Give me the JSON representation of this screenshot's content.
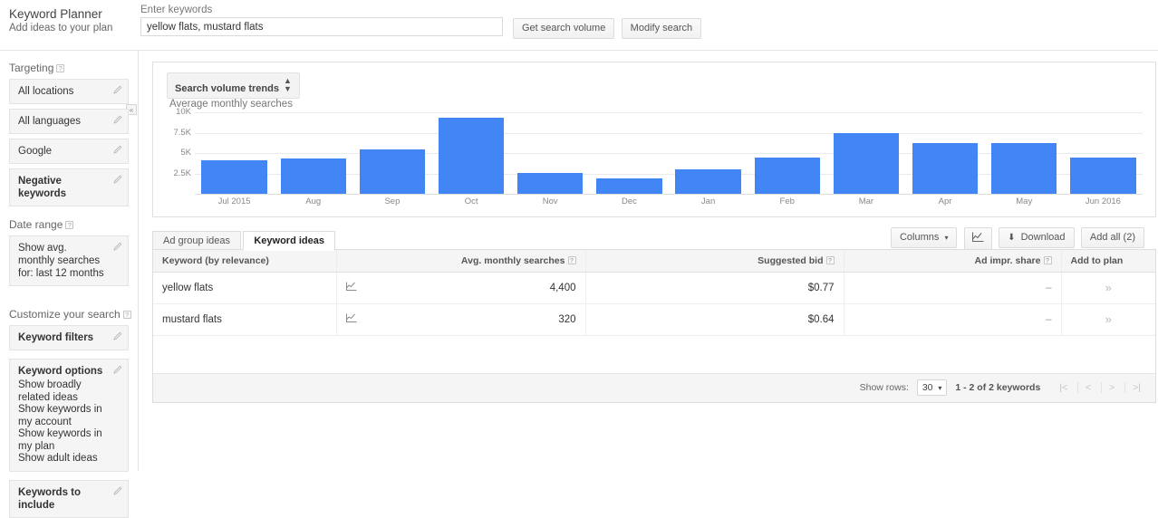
{
  "header": {
    "title": "Keyword Planner",
    "subtitle": "Add ideas to your plan",
    "keywords_label": "Enter keywords",
    "keywords_value": "yellow flats, mustard flats",
    "keywords_placeholder": "Enter keywords",
    "get_volume_label": "Get search volume",
    "modify_search_label": "Modify search",
    "collapse_glyph": "«"
  },
  "sidebar": {
    "targeting": {
      "heading": "Targeting",
      "items": [
        {
          "label": "All locations"
        },
        {
          "label": "All languages"
        },
        {
          "label": "Google"
        },
        {
          "label": "Negative keywords"
        }
      ]
    },
    "date_range": {
      "heading": "Date range",
      "value": "Show avg. monthly searches for: last 12 months"
    },
    "customize": {
      "heading": "Customize your search",
      "keyword_filters": "Keyword filters",
      "keyword_options": "Keyword options",
      "options": [
        "Show broadly related ideas",
        "Show keywords in my account",
        "Show keywords in my plan",
        "Show adult ideas"
      ],
      "keywords_to_include": "Keywords to include"
    }
  },
  "chart_panel": {
    "selector_label": "Search volume trends"
  },
  "chart_data": {
    "type": "bar",
    "title": "Average monthly searches",
    "xlabel": "",
    "ylabel": "",
    "ylim": [
      0,
      10000
    ],
    "yticks": [
      2500,
      5000,
      7500,
      10000
    ],
    "ytick_labels": [
      "2.5K",
      "5K",
      "7.5K",
      "10K"
    ],
    "grid": true,
    "legend": "none",
    "bar_color": "#4285f4",
    "categories": [
      "Jul 2015",
      "Aug",
      "Sep",
      "Oct",
      "Nov",
      "Dec",
      "Jan",
      "Feb",
      "Mar",
      "Apr",
      "May",
      "Jun 2016"
    ],
    "values": [
      4100,
      4300,
      5450,
      9350,
      2550,
      1850,
      3000,
      4400,
      7500,
      6250,
      6250,
      4500
    ]
  },
  "tabs": [
    {
      "label": "Ad group ideas",
      "active": false
    },
    {
      "label": "Keyword ideas",
      "active": true
    }
  ],
  "toolbar": {
    "columns_label": "Columns",
    "columns_caret": "▾",
    "graph_icon": "graph-icon",
    "download_label": "Download",
    "download_icon": "⬇",
    "add_all_label": "Add all (2)"
  },
  "table": {
    "columns": [
      "Keyword (by relevance)",
      "",
      "Avg. monthly searches",
      "Suggested bid",
      "Ad impr. share",
      "Add to plan"
    ],
    "rows": [
      {
        "keyword": "yellow flats",
        "trend": "trend-icon",
        "avg_monthly_searches": "4,400",
        "suggested_bid": "$0.77",
        "ad_impr_share": "–",
        "add": "»"
      },
      {
        "keyword": "mustard flats",
        "trend": "trend-icon",
        "avg_monthly_searches": "320",
        "suggested_bid": "$0.64",
        "ad_impr_share": "–",
        "add": "»"
      }
    ],
    "footer": {
      "show_rows_label": "Show rows:",
      "rows_value": "30",
      "rows_caret": "▾",
      "range_label": "1 - 2 of 2 keywords",
      "first_glyph": "|<",
      "prev_glyph": "<",
      "next_glyph": ">",
      "last_glyph": ">|"
    }
  }
}
